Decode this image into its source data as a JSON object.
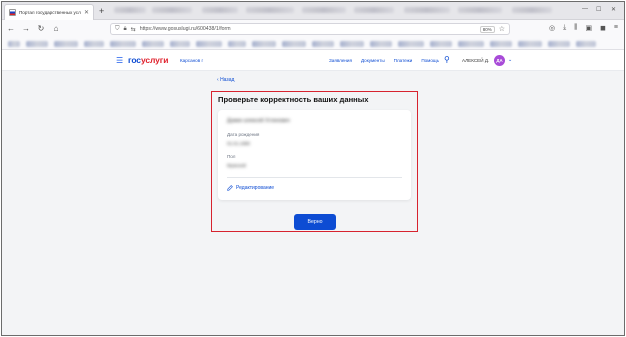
{
  "browser": {
    "tab_title": "Портал государственных усл",
    "url": "https://www.gosuslugi.ru/600438/1/form",
    "zoom": "80%"
  },
  "header": {
    "logo_gos": "гос",
    "logo_uslugi": "услуги",
    "location": "Карсанов г",
    "nav": [
      "Заявления",
      "Документы",
      "Платежи",
      "Помощь"
    ],
    "user_name": "АЛЕКСЕЙ Д.",
    "avatar_initials": "ДА"
  },
  "main": {
    "back_label": "Назад",
    "title": "Проверьте корректность ваших данных",
    "full_name": "Думин алексей Устинович",
    "birth_label": "Дата рождения",
    "birth_value": "01.01.1990",
    "sex_label": "Пол",
    "sex_value": "Мужской",
    "edit_label": "Редактирование",
    "confirm_label": "Верно"
  },
  "colors": {
    "brand_blue": "#0d4cd3",
    "brand_red": "#e0222d",
    "highlight_red": "#d7232f",
    "avatar_bg": "#a84bd8"
  }
}
